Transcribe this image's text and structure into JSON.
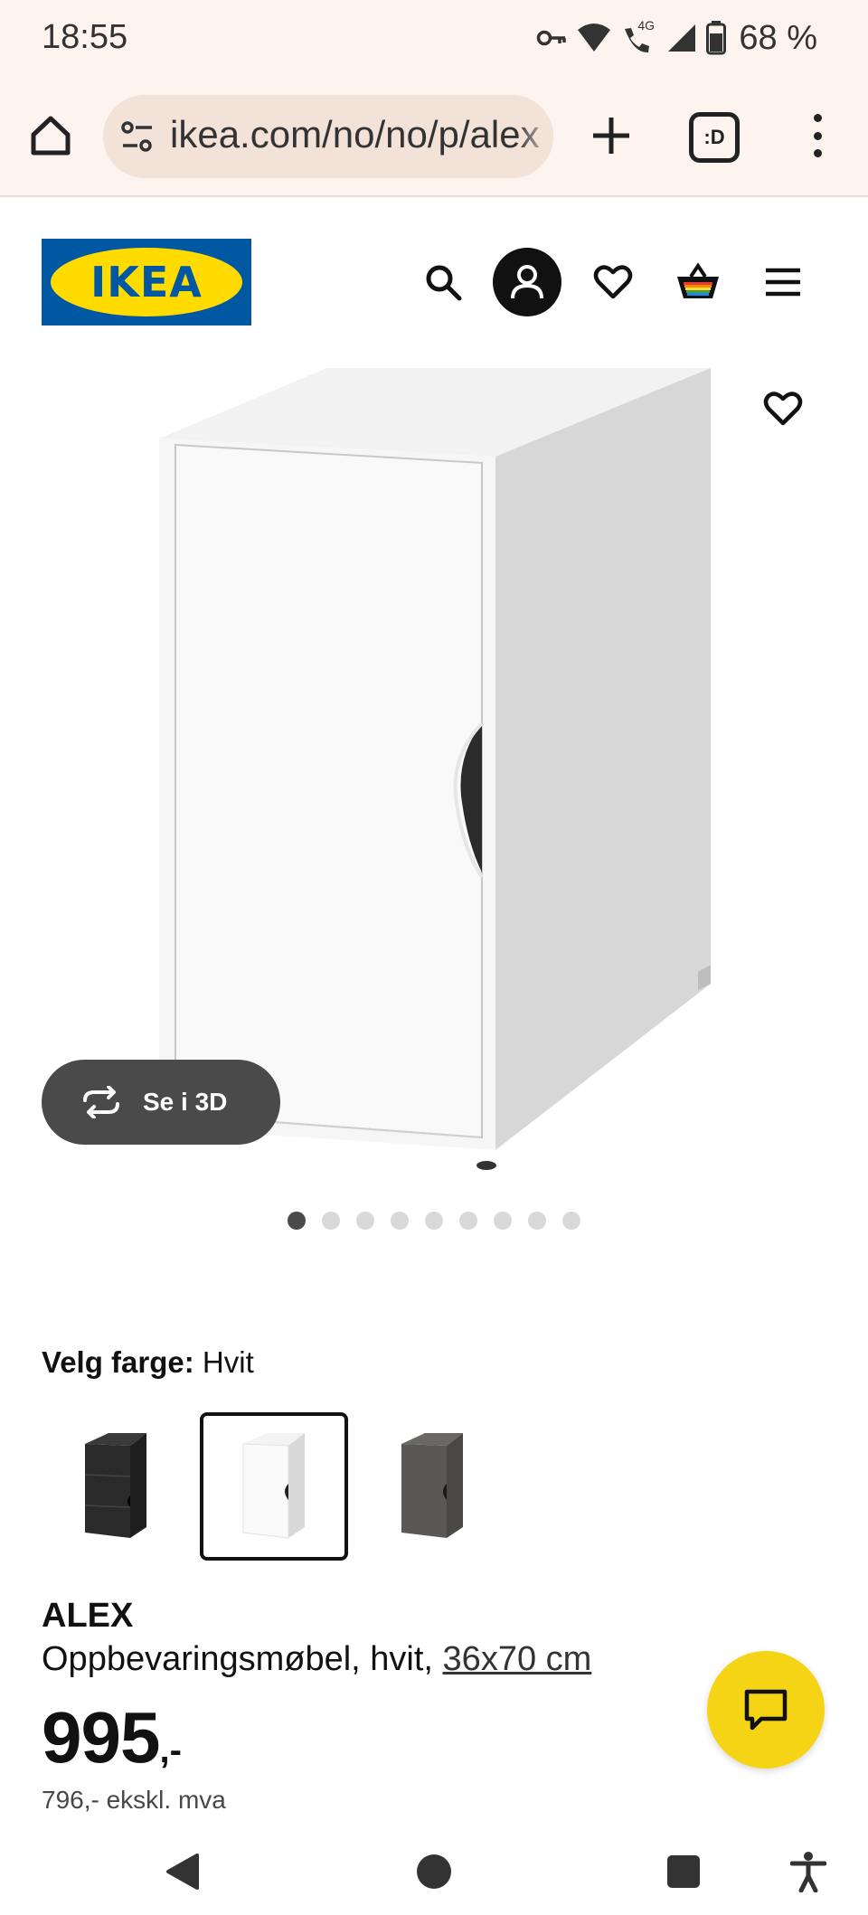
{
  "status_bar": {
    "time": "18:55",
    "network": "4G",
    "battery": "68 %",
    "icons": [
      "vpn-key-icon",
      "wifi-icon",
      "wifi-calling-icon",
      "signal-icon",
      "battery-icon"
    ]
  },
  "browser": {
    "url": "ikea.com/no/no/p/alex",
    "tabs_label": ":D",
    "icons": [
      "home-icon",
      "site-settings-icon",
      "plus-icon",
      "more-icon"
    ]
  },
  "header": {
    "logo_text": "IKEA",
    "brand_colors": {
      "blue": "#0058a3",
      "yellow": "#ffdb00"
    },
    "icons": [
      "search-icon",
      "profile-icon",
      "heart-icon",
      "basket-icon",
      "hamburger-menu-icon"
    ]
  },
  "gallery": {
    "button_3d_label": "Se i 3D",
    "image_count": 9,
    "active_image": 1
  },
  "color_picker": {
    "label": "Velg farge:",
    "selected": "Hvit",
    "swatches": [
      {
        "name": "black",
        "color": "#2a2a2a",
        "selected": false
      },
      {
        "name": "white",
        "color": "#f4f4f4",
        "selected": true
      },
      {
        "name": "grey",
        "color": "#5a5856",
        "selected": false
      }
    ]
  },
  "product": {
    "name": "ALEX",
    "description": "Oppbevaringsmøbel, hvit,",
    "dimensions": "36x70 cm",
    "price": "995",
    "price_suffix": ",-",
    "price_ex_vat": "796,- ekskl. mva"
  },
  "accent_color": "#f5d416",
  "nav": {
    "icons": [
      "back-icon",
      "home-nav-icon",
      "recents-icon",
      "accessibility-icon"
    ]
  }
}
